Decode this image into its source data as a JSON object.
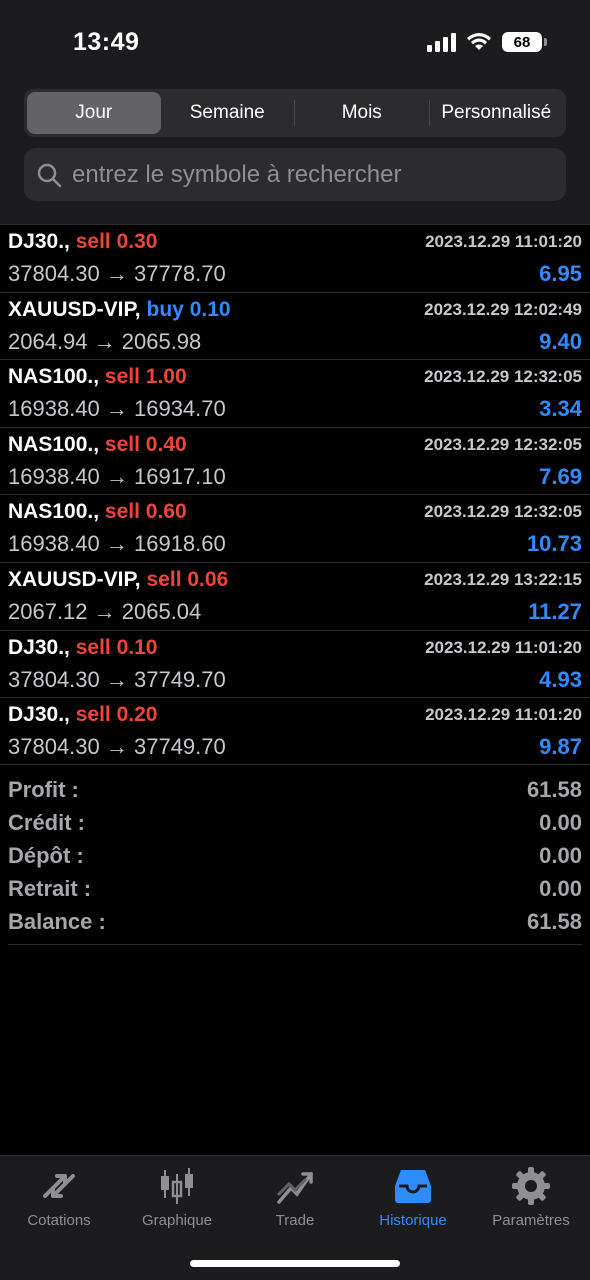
{
  "status": {
    "time": "13:49",
    "battery": "68"
  },
  "tabs_period": [
    "Jour",
    "Semaine",
    "Mois",
    "Personnalisé"
  ],
  "search": {
    "placeholder": "entrez le symbole à rechercher"
  },
  "trades": [
    {
      "symbol": "DJ30.,",
      "side": "sell",
      "volume": "0.30",
      "time": "2023.12.29 11:01:20",
      "prices": "37804.30 → 37778.70",
      "profit": "6.95"
    },
    {
      "symbol": "XAUUSD-VIP,",
      "side": "buy",
      "volume": "0.10",
      "time": "2023.12.29 12:02:49",
      "prices": "2064.94 → 2065.98",
      "profit": "9.40"
    },
    {
      "symbol": "NAS100.,",
      "side": "sell",
      "volume": "1.00",
      "time": "2023.12.29 12:32:05",
      "prices": "16938.40 → 16934.70",
      "profit": "3.34"
    },
    {
      "symbol": "NAS100.,",
      "side": "sell",
      "volume": "0.40",
      "time": "2023.12.29 12:32:05",
      "prices": "16938.40 → 16917.10",
      "profit": "7.69"
    },
    {
      "symbol": "NAS100.,",
      "side": "sell",
      "volume": "0.60",
      "time": "2023.12.29 12:32:05",
      "prices": "16938.40 → 16918.60",
      "profit": "10.73"
    },
    {
      "symbol": "XAUUSD-VIP,",
      "side": "sell",
      "volume": "0.06",
      "time": "2023.12.29 13:22:15",
      "prices": "2067.12 → 2065.04",
      "profit": "11.27"
    },
    {
      "symbol": "DJ30.,",
      "side": "sell",
      "volume": "0.10",
      "time": "2023.12.29 11:01:20",
      "prices": "37804.30 → 37749.70",
      "profit": "4.93"
    },
    {
      "symbol": "DJ30.,",
      "side": "sell",
      "volume": "0.20",
      "time": "2023.12.29 11:01:20",
      "prices": "37804.30 → 37749.70",
      "profit": "9.87"
    }
  ],
  "summary": [
    {
      "label": "Profit :",
      "value": "61.58"
    },
    {
      "label": "Crédit :",
      "value": "0.00"
    },
    {
      "label": "Dépôt :",
      "value": "0.00"
    },
    {
      "label": "Retrait :",
      "value": "0.00"
    },
    {
      "label": "Balance :",
      "value": "61.58"
    }
  ],
  "bottom_tabs": [
    {
      "label": "Cotations",
      "icon": "quotes-arrows-icon"
    },
    {
      "label": "Graphique",
      "icon": "candlestick-chart-icon"
    },
    {
      "label": "Trade",
      "icon": "trade-trend-icon"
    },
    {
      "label": "Historique",
      "icon": "inbox-history-icon"
    },
    {
      "label": "Paramètres",
      "icon": "gear-icon"
    }
  ],
  "colors": {
    "accent": "#2f8cff",
    "sell": "#f04438",
    "background": "#000000",
    "panel": "#1c1c1e"
  }
}
